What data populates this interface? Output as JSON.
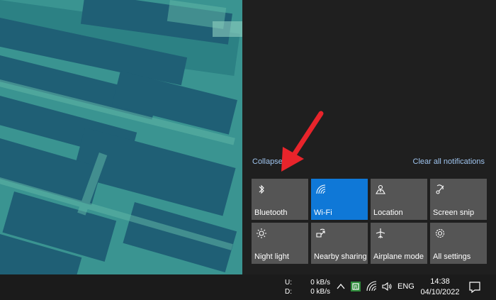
{
  "action_center": {
    "collapse_label": "Collapse",
    "clear_label": "Clear all notifications",
    "tiles": [
      {
        "label": "Bluetooth",
        "icon": "bluetooth-icon",
        "active": false
      },
      {
        "label": "Wi-Fi",
        "icon": "wifi-icon",
        "active": true
      },
      {
        "label": "Location",
        "icon": "location-icon",
        "active": false
      },
      {
        "label": "Screen snip",
        "icon": "screen-snip-icon",
        "active": false
      },
      {
        "label": "Night light",
        "icon": "night-light-icon",
        "active": false
      },
      {
        "label": "Nearby sharing",
        "icon": "nearby-sharing-icon",
        "active": false
      },
      {
        "label": "Airplane mode",
        "icon": "airplane-icon",
        "active": false
      },
      {
        "label": "All settings",
        "icon": "settings-icon",
        "active": false
      }
    ],
    "colors": {
      "tile": "#555555",
      "tile_active": "#0f78d7",
      "link": "#9fc4ee",
      "annotation": "#e8242b"
    }
  },
  "taskbar": {
    "net_upload_label": "U:",
    "net_download_label": "D:",
    "net_upload_value": "0 kB/s",
    "net_download_value": "0 kB/s",
    "language": "ENG",
    "time": "14:38",
    "date": "04/10/2022"
  }
}
